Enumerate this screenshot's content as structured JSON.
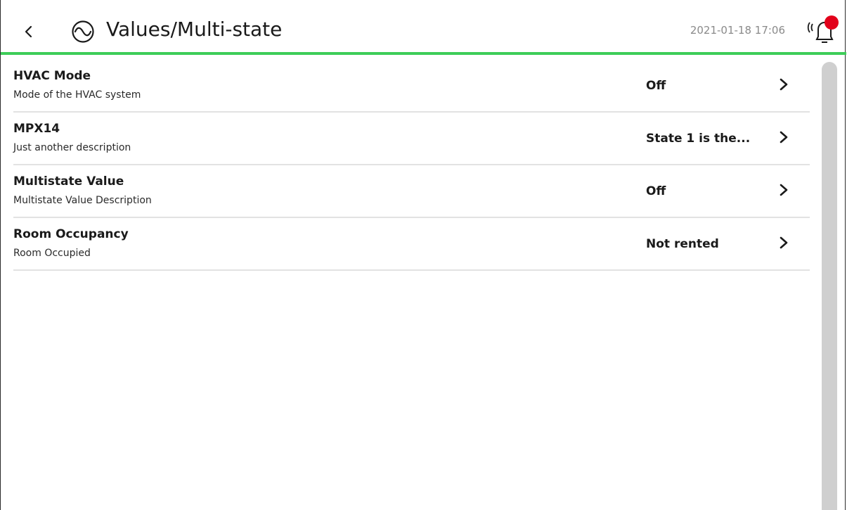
{
  "header": {
    "title": "Values/Multi-state",
    "timestamp": "2021-01-18 17:06",
    "accent_color": "#3dcd58",
    "alarm_dot_color": "#e2001a",
    "back_icon": "chevron-left-icon",
    "page_icon": "sine-wave-icon",
    "alarm_icon": "alarm-bell-icon"
  },
  "items": [
    {
      "name": "HVAC Mode",
      "description": "Mode of the HVAC system",
      "value": "Off"
    },
    {
      "name": "MPX14",
      "description": "Just another description",
      "value": "State 1 is the..."
    },
    {
      "name": "Multistate Value",
      "description": "Multistate Value Description",
      "value": "Off"
    },
    {
      "name": "Room Occupancy",
      "description": "Room Occupied",
      "value": "Not rented"
    }
  ]
}
